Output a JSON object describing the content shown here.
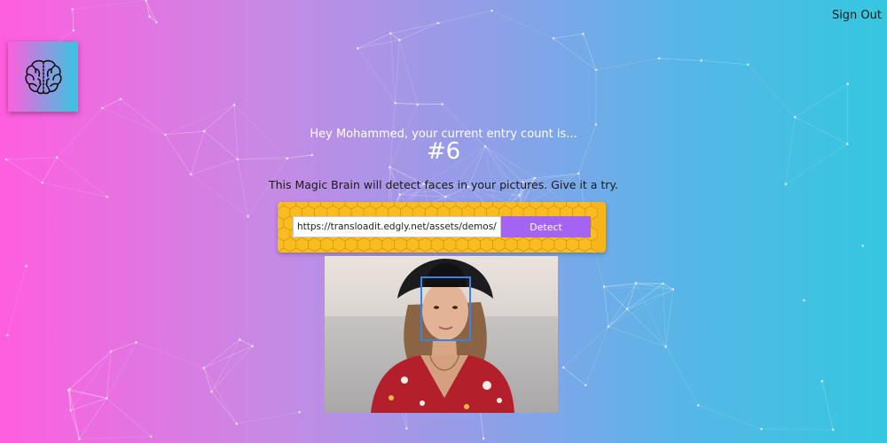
{
  "nav": {
    "signout_label": "Sign Out"
  },
  "logo": {
    "icon": "brain-icon"
  },
  "rank": {
    "greeting": "Hey Mohammed, your current entry count is...",
    "count": "#6"
  },
  "intro": {
    "text": "This Magic Brain will detect faces in your pictures. Give it a try."
  },
  "form": {
    "url_value": "https://transloadit.edgly.net/assets/demos/outputs/faces.jpg",
    "button_label": "Detect"
  },
  "colors": {
    "gradient_left": "#ff5edf",
    "gradient_right": "#35c7e0",
    "form_yellow": "#f7b51c",
    "button_purple": "#a463f2",
    "face_box": "#3f81e0"
  }
}
